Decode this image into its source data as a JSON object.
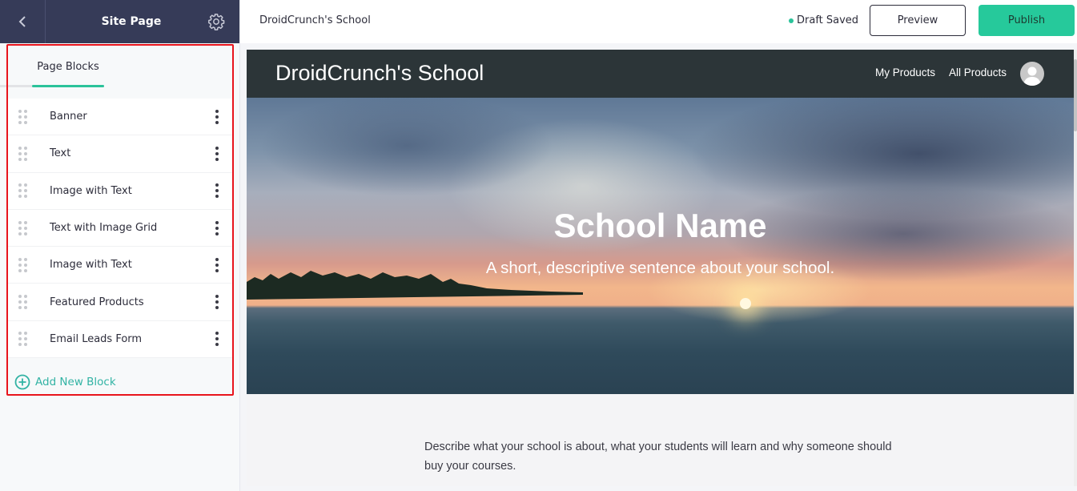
{
  "sidebar": {
    "title": "Site Page",
    "tab_label": "Page Blocks",
    "blocks": [
      {
        "label": "Banner"
      },
      {
        "label": "Text"
      },
      {
        "label": "Image with Text"
      },
      {
        "label": "Text with Image Grid"
      },
      {
        "label": "Image with Text"
      },
      {
        "label": "Featured Products"
      },
      {
        "label": "Email Leads Form"
      }
    ],
    "add_block_label": "Add New Block"
  },
  "topbar": {
    "site_name": "DroidCrunch's School",
    "status": "Draft Saved",
    "preview_label": "Preview",
    "publish_label": "Publish"
  },
  "preview": {
    "brand": "DroidCrunch's School",
    "nav": {
      "my_products": "My Products",
      "all_products": "All Products"
    },
    "hero": {
      "title": "School Name",
      "subtitle": "A short, descriptive sentence about your school."
    },
    "description": "Describe what your school is about, what your students will learn and why someone should buy your courses."
  },
  "colors": {
    "sidebar_header": "#363b58",
    "accent_green": "#26c99b",
    "add_block_teal": "#32b3a4",
    "site_nav": "#2c3538",
    "highlight_red": "#e8141c"
  }
}
